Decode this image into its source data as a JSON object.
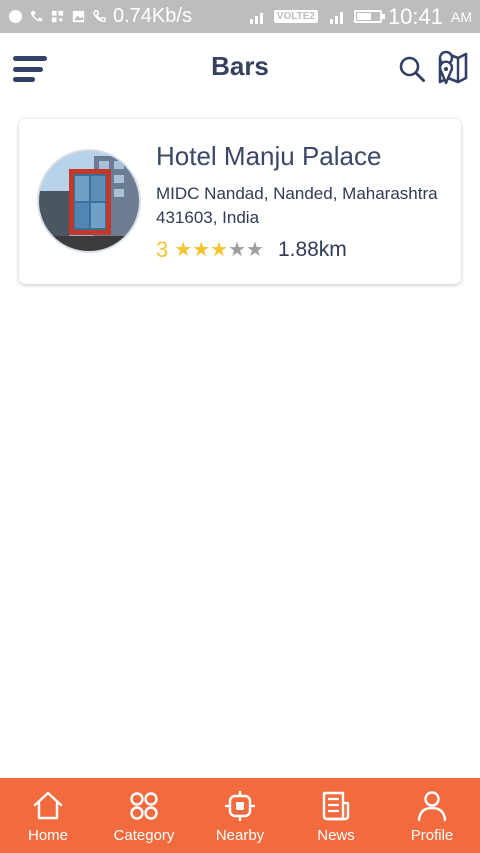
{
  "status_bar": {
    "network_speed": "0.74Kb/s",
    "volte": "VOLTE2",
    "time": "10:41",
    "ampm": "AM"
  },
  "header": {
    "title": "Bars",
    "icons": [
      "menu-icon",
      "search-icon",
      "map-icon"
    ]
  },
  "listing": {
    "name": "Hotel Manju Palace",
    "address": "MIDC Nandad, Nanded, Maharashtra 431603, India",
    "rating": "3",
    "rating_value": 3,
    "rating_max": 5,
    "distance": "1.88km",
    "star_color_filled": "#f4c430",
    "star_color_empty": "#9e9e9e"
  },
  "bottom_nav": {
    "background": "#f26b3f",
    "items": [
      {
        "label": "Home",
        "icon": "home-icon"
      },
      {
        "label": "Category",
        "icon": "category-icon"
      },
      {
        "label": "Nearby",
        "icon": "nearby-icon"
      },
      {
        "label": "News",
        "icon": "news-icon"
      },
      {
        "label": "Profile",
        "icon": "profile-icon"
      }
    ]
  }
}
